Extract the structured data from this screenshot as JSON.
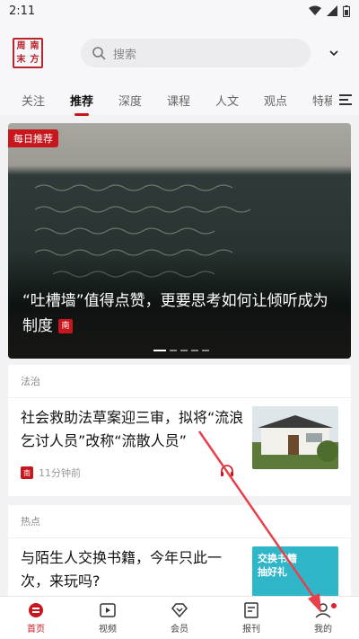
{
  "status": {
    "time": "2:11"
  },
  "header": {
    "logo_chars": [
      "周",
      "南",
      "末",
      "方"
    ],
    "search_placeholder": "搜索"
  },
  "tabs": [
    {
      "label": "关注",
      "active": false
    },
    {
      "label": "推荐",
      "active": true
    },
    {
      "label": "深度",
      "active": false
    },
    {
      "label": "课程",
      "active": false
    },
    {
      "label": "人文",
      "active": false
    },
    {
      "label": "观点",
      "active": false
    },
    {
      "label": "特稿",
      "active": false
    }
  ],
  "hero": {
    "badge": "每日推荐",
    "title": "“吐槽墙”值得点赞，更要思考如何让倾听成为制度",
    "brand": "南"
  },
  "cards": [
    {
      "section": "法治",
      "title": "社会救助法草案迎三审，拟将“流浪乞讨人员”改称“流散人员”",
      "time": "11分钟前",
      "brand": "南"
    },
    {
      "section": "热点",
      "title": "与陌生人交换书籍，今年只此一次，来玩吗?",
      "thumb_text": "交换书籍 抽好礼"
    }
  ],
  "bottom_nav": [
    {
      "label": "首页",
      "icon": "home-icon",
      "active": true
    },
    {
      "label": "视频",
      "icon": "video-icon",
      "active": false
    },
    {
      "label": "会员",
      "icon": "member-icon",
      "active": false
    },
    {
      "label": "报刊",
      "icon": "newspaper-icon",
      "active": false
    },
    {
      "label": "我的",
      "icon": "profile-icon",
      "active": false,
      "dot": true
    }
  ],
  "colors": {
    "brand_red": "#c8161d",
    "annotation_arrow": "#e8404a"
  }
}
